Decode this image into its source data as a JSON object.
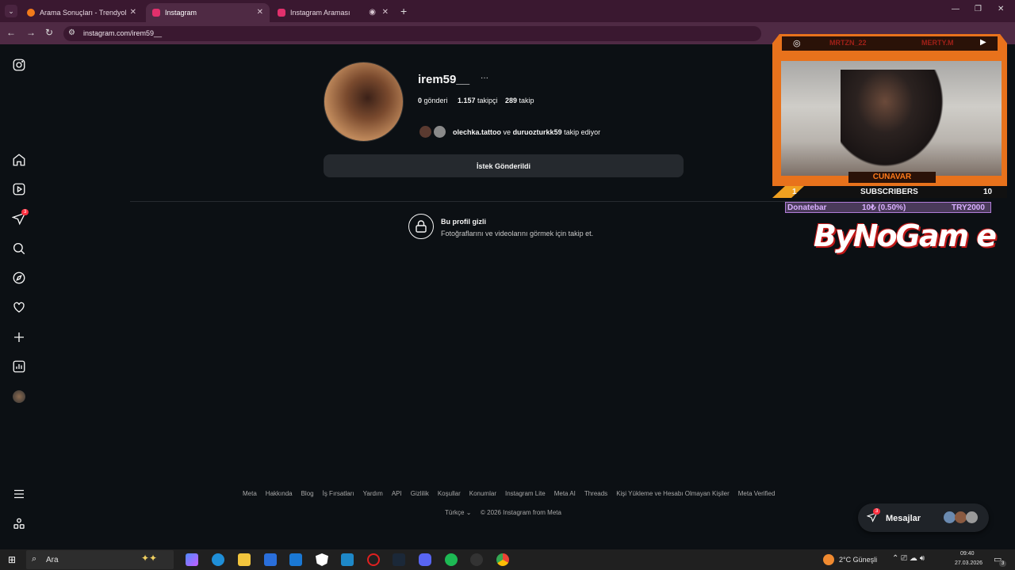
{
  "browser": {
    "tabs": [
      {
        "title": "Arama Sonuçları - Trendyol",
        "fav_color": "#f27a1a"
      },
      {
        "title": "Instagram",
        "fav_color": "#e1306c"
      },
      {
        "title": "Instagram Araması",
        "fav_color": "#e1306c"
      }
    ],
    "url": "instagram.com/irem59__"
  },
  "profile": {
    "username": "irem59__",
    "posts_count": "0",
    "posts_label": "gönderi",
    "followers_count": "1.157",
    "followers_label": "takipçi",
    "following_count": "289",
    "following_label": "takip",
    "mutual_user1": "olechka.tattoo",
    "mutual_and": "ve",
    "mutual_user2": "duruozturkk59",
    "mutual_suffix": "takip ediyor",
    "request_button": "İstek Gönderildi",
    "private_title": "Bu profil gizli",
    "private_sub": "Fotoğraflarını ve videolarını görmek için takip et."
  },
  "sidebar": {
    "notification_badge": "3"
  },
  "footer": {
    "links": [
      "Meta",
      "Hakkında",
      "Blog",
      "İş Fırsatları",
      "Yardım",
      "API",
      "Gizlilik",
      "Koşullar",
      "Konumlar",
      "Instagram Lite",
      "Meta AI",
      "Threads",
      "Kişi Yükleme ve Hesabı Olmayan Kişiler",
      "Meta Verified"
    ],
    "language": "Türkçe",
    "copyright": "© 2026 Instagram from Meta"
  },
  "messages": {
    "label": "Mesajlar",
    "badge": "3"
  },
  "overlay": {
    "name_left": "MRTZN_22",
    "name_right": "MERTY.M",
    "cam_name": "CUNAVAR",
    "subs_left": "1",
    "subs_title": "SUBSCRIBERS",
    "subs_right": "10",
    "donate_label": "Donatebar",
    "donate_mid": "10₺ (0.50%)",
    "donate_right": "TRY2000",
    "brand": "ByNoGam e"
  },
  "taskbar": {
    "search": "Ara",
    "weather": "2°C  Güneşli",
    "time": "09:40",
    "date": "27.03.2026",
    "notif": "3"
  }
}
